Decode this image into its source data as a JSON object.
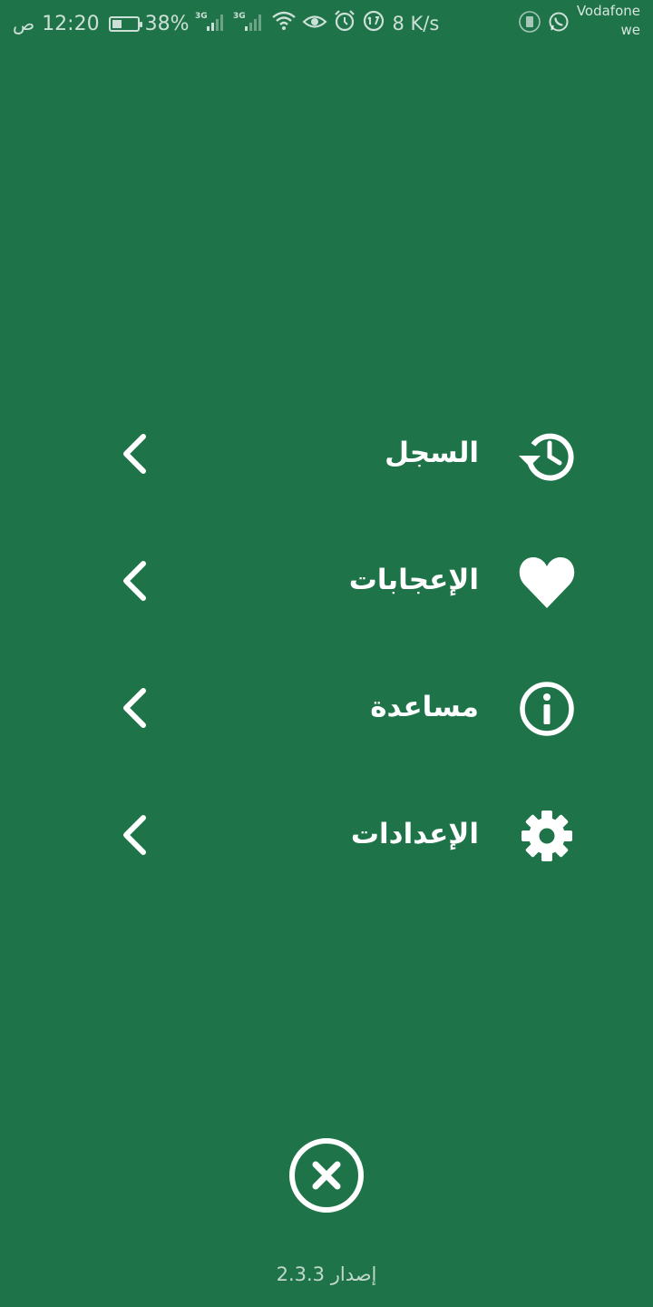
{
  "status_bar": {
    "ampm": "ص",
    "time": "12:20",
    "battery_percent_label": "38%",
    "battery_level": 0.38,
    "network_1": "3G",
    "network_2": "3G",
    "speed": "8 K/s",
    "carrier_line1": "Vodafone",
    "carrier_line2": "we"
  },
  "menu": {
    "items": [
      {
        "label": "السجل",
        "icon": "history-icon"
      },
      {
        "label": "الإعجابات",
        "icon": "heart-icon"
      },
      {
        "label": "مساعدة",
        "icon": "info-icon"
      },
      {
        "label": "الإعدادات",
        "icon": "gear-icon"
      }
    ]
  },
  "footer": {
    "version": "إصدار 2.3.3"
  },
  "colors": {
    "background": "#1f7349",
    "foreground": "#ffffff"
  }
}
